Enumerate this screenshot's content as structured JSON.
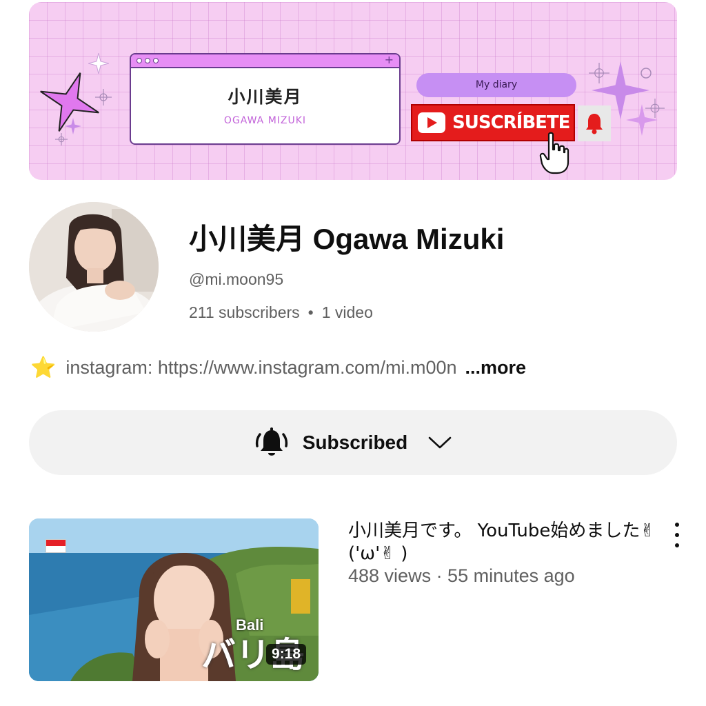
{
  "banner": {
    "title_jp": "小川美月",
    "title_en": "OGAWA MIZUKI",
    "diary_label": "My diary",
    "subscribe_label": "SUSCRÍBETE"
  },
  "channel": {
    "name": "小川美月 Ogawa Mizuki",
    "handle": "@mi.moon95",
    "subscribers": "211 subscribers",
    "separator": "•",
    "videos": "1 video",
    "description": "instagram: https://www.instagram.com/mi.m00n",
    "more_label": "...more",
    "description_icon": "star-icon"
  },
  "subscribe_button": {
    "label": "Subscribed",
    "bell_icon": "bell-ringing-icon",
    "dropdown_icon": "chevron-down-icon"
  },
  "video": {
    "title": "小川美月です。 YouTube始めました✌('ω'✌ )",
    "meta": "488 views · 55 minutes ago",
    "duration": "9:18",
    "thumb_text_en": "Bali",
    "thumb_text_jp": "バリ島"
  },
  "colors": {
    "banner_pink": "#f6cdf2",
    "youtube_red": "#e41c1c",
    "accent_purple": "#c68ff3"
  }
}
